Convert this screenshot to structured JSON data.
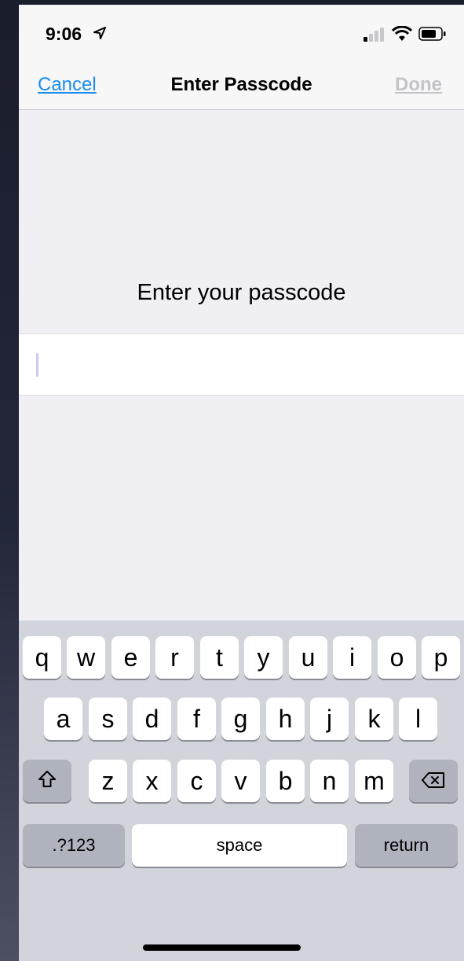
{
  "status_bar": {
    "time": "9:06",
    "icons": [
      "location-arrow-icon",
      "signal-icon",
      "wifi-icon",
      "battery-icon"
    ]
  },
  "nav": {
    "cancel": "Cancel",
    "title": "Enter Passcode",
    "done": "Done"
  },
  "prompt": "Enter your passcode",
  "field": {
    "value": "",
    "placeholder": ""
  },
  "keyboard": {
    "row1": [
      "q",
      "w",
      "e",
      "r",
      "t",
      "y",
      "u",
      "i",
      "o",
      "p"
    ],
    "row2": [
      "a",
      "s",
      "d",
      "f",
      "g",
      "h",
      "j",
      "k",
      "l"
    ],
    "row3": [
      "z",
      "x",
      "c",
      "v",
      "b",
      "n",
      "m"
    ],
    "numbers": ".?123",
    "space": "space",
    "return": "return"
  },
  "colors": {
    "accent": "#1a8cf0",
    "disabled": "#c4c4c8",
    "keyboard_bg": "#d1d4da",
    "key_dark": "#aeb3bd"
  }
}
